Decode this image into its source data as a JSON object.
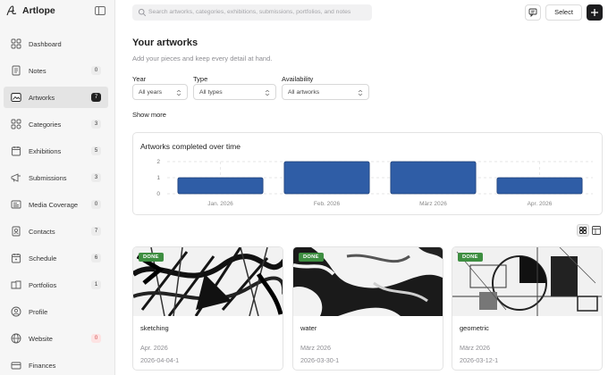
{
  "app": {
    "name": "Artlope"
  },
  "sidebar": {
    "items": [
      {
        "label": "Dashboard",
        "icon": "dashboard-icon",
        "badge": ""
      },
      {
        "label": "Notes",
        "icon": "notes-icon",
        "badge": "0"
      },
      {
        "label": "Artworks",
        "icon": "artworks-icon",
        "badge": "7",
        "active": true
      },
      {
        "label": "Categories",
        "icon": "categories-icon",
        "badge": "3"
      },
      {
        "label": "Exhibitions",
        "icon": "exhibitions-icon",
        "badge": "5"
      },
      {
        "label": "Submissions",
        "icon": "submissions-icon",
        "badge": "3"
      },
      {
        "label": "Media Coverage",
        "icon": "media-coverage-icon",
        "badge": "0"
      },
      {
        "label": "Contacts",
        "icon": "contacts-icon",
        "badge": "7"
      },
      {
        "label": "Schedule",
        "icon": "schedule-icon",
        "badge": "6"
      },
      {
        "label": "Portfolios",
        "icon": "portfolios-icon",
        "badge": "1"
      },
      {
        "label": "Profile",
        "icon": "profile-icon",
        "badge": ""
      },
      {
        "label": "Website",
        "icon": "website-icon",
        "badge": "0",
        "badge_color": "#d14343"
      },
      {
        "label": "Finances",
        "icon": "finances-icon",
        "badge": ""
      }
    ]
  },
  "topbar": {
    "search_placeholder": "Search artworks, categories, exhibitions, submissions, portfolios, and notes",
    "select_label": "Select"
  },
  "main": {
    "title": "Your artworks",
    "subtitle": "Add your pieces and keep every detail at hand.",
    "filters": [
      {
        "label": "Year",
        "value": "All years"
      },
      {
        "label": "Type",
        "value": "All types"
      },
      {
        "label": "Availability",
        "value": "All artworks"
      }
    ],
    "show_more": "Show more"
  },
  "chart": {
    "title": "Artworks completed over time"
  },
  "chart_data": {
    "type": "bar",
    "title": "Artworks completed over time",
    "categories": [
      "Jan. 2026",
      "Feb. 2026",
      "März 2026",
      "Apr. 2026"
    ],
    "values": [
      1,
      2,
      2,
      1
    ],
    "yticks": [
      "0",
      "1",
      "2"
    ],
    "ylim": [
      0,
      2
    ],
    "grid": true,
    "bar_color": "#2f5da6"
  },
  "artworks": [
    {
      "status": "DONE",
      "title": "sketching",
      "month": "Apr. 2026",
      "date": "2026-04-04-1"
    },
    {
      "status": "DONE",
      "title": "water",
      "month": "März 2026",
      "date": "2026-03-30-1"
    },
    {
      "status": "DONE",
      "title": "geometric",
      "month": "März 2026",
      "date": "2026-03-12-1"
    }
  ],
  "colors": {
    "accent": "#1d1d1f",
    "done_badge": "#3e8e41",
    "bar": "#2f5da6"
  }
}
